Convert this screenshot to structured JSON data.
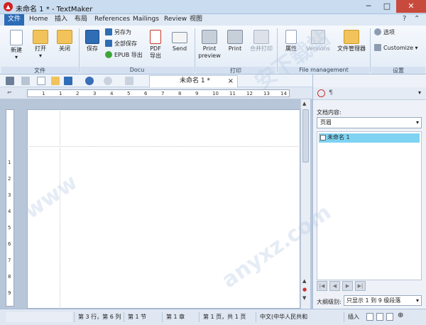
{
  "window": {
    "title": "未命名 1 * - TextMaker"
  },
  "menu": {
    "items": [
      "文件",
      "Home",
      "插入",
      "布局",
      "References",
      "Mailings",
      "Review",
      "视图"
    ],
    "active_index": 0
  },
  "ribbon": {
    "file_group": {
      "new": "新建",
      "open": "打开",
      "close": "关闭",
      "label": "文件"
    },
    "document_group": {
      "save": "保存",
      "save_as": "另存为",
      "save_all": "全部保存",
      "epub": "EPUB 导出",
      "pdf_line1": "PDF",
      "pdf_line2": "导出",
      "send": "Send",
      "label": "Docu"
    },
    "print_group": {
      "preview_line1": "Print",
      "preview_line2": "preview",
      "print": "Print",
      "merge_print": "合并打印",
      "label": "打印"
    },
    "file_mgmt_group": {
      "properties": "属性",
      "versions": "Versions",
      "file_manager": "文件管理器",
      "label": "File management"
    },
    "settings_group": {
      "options": "选项",
      "customize": "Customize",
      "label": "设置"
    }
  },
  "document_tab": {
    "title": "未命名 1 *",
    "close": "×"
  },
  "ruler": {
    "numbers": [
      "1",
      "1",
      "2",
      "3",
      "4",
      "5",
      "6",
      "7",
      "8",
      "9",
      "10",
      "11",
      "12",
      "13",
      "14"
    ]
  },
  "vruler": {
    "numbers": [
      "1",
      "2",
      "3",
      "4",
      "5",
      "6",
      "7",
      "8",
      "9"
    ]
  },
  "side_panel": {
    "section_label": "文档内容:",
    "selector_value": "页眉",
    "outline_items": [
      "未命名 1"
    ],
    "level_label": "大纲级别:",
    "level_value": "只显示 1 到 9 级段落"
  },
  "status": {
    "line_col": "第 3 行，第 6 列",
    "section": "第 1 节",
    "chapter": "第 1 章",
    "page": "第 1 页，共 1 页",
    "language": "中文(中华人民共和",
    "mode": "插入"
  },
  "colors": {
    "accent": "#2c6cb7",
    "close_button": "#c84a3c",
    "outline_highlight": "#7ed3f2"
  }
}
